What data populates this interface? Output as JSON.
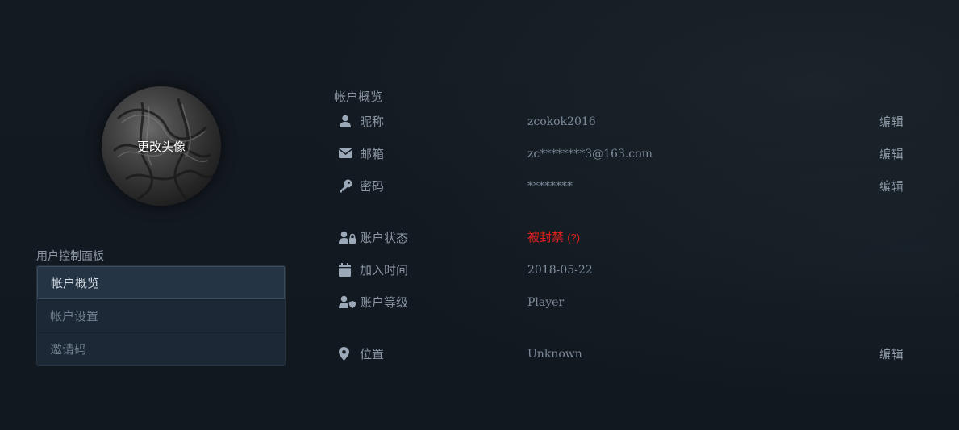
{
  "avatar": {
    "change_label": "更改头像"
  },
  "panel": {
    "title": "用户控制面板",
    "items": [
      {
        "label": "帐户概览",
        "active": true
      },
      {
        "label": "帐户设置",
        "active": false
      },
      {
        "label": "邀请码",
        "active": false
      }
    ]
  },
  "overview": {
    "title": "帐户概览",
    "edit_label": "编辑",
    "rows": {
      "nickname": {
        "icon": "user-icon",
        "label": "昵称",
        "value": "zcokok2016"
      },
      "email": {
        "icon": "envelope-icon",
        "label": "邮箱",
        "value": "zc********3@163.com"
      },
      "password": {
        "icon": "key-icon",
        "label": "密码",
        "value": "********"
      },
      "status": {
        "icon": "user-lock-icon",
        "label": "账户状态",
        "value": "被封禁",
        "hint": "(?)",
        "color": "#e0201a"
      },
      "joined": {
        "icon": "calendar-icon",
        "label": "加入时间",
        "value": "2018-05-22"
      },
      "level": {
        "icon": "user-shield-icon",
        "label": "账户等级",
        "value": "Player"
      },
      "location": {
        "icon": "map-marker-icon",
        "label": "位置",
        "value": "Unknown"
      }
    }
  }
}
